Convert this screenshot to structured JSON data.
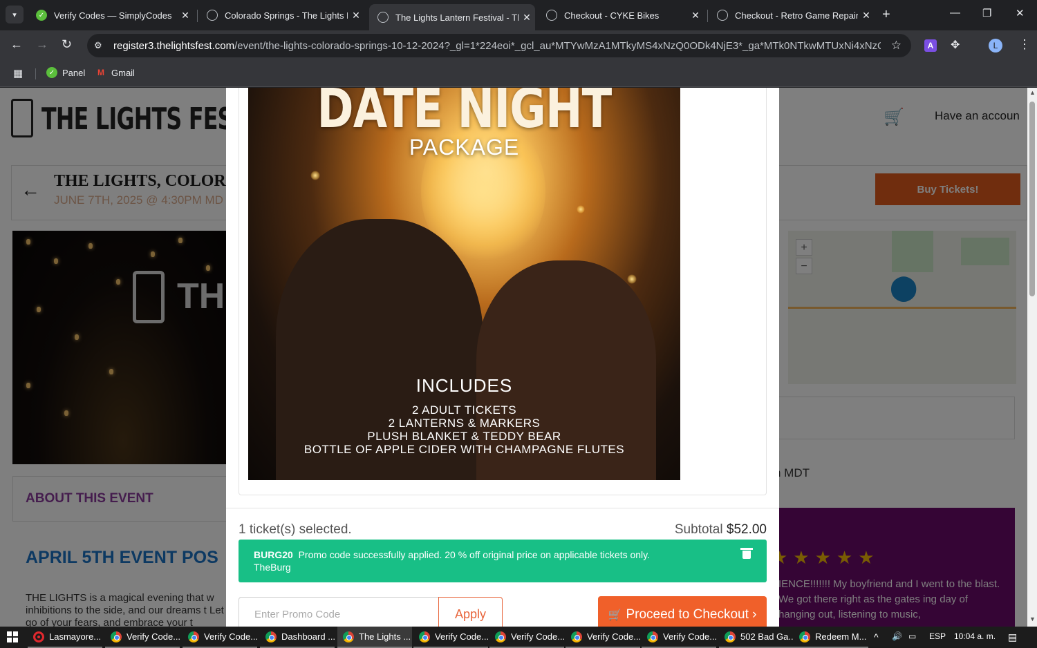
{
  "browser": {
    "tabs": [
      {
        "title": "Verify Codes — SimplyCodes",
        "icon": "simplycodes-icon",
        "active": false
      },
      {
        "title": "Colorado Springs - The Lights L",
        "icon": "globe-icon",
        "active": false
      },
      {
        "title": "The Lights Lantern Festival - Th",
        "icon": "globe-icon",
        "active": true
      },
      {
        "title": "Checkout - CYKE Bikes",
        "icon": "globe-icon",
        "active": false
      },
      {
        "title": "Checkout - Retro Game Repair",
        "icon": "globe-icon",
        "active": false
      }
    ],
    "close_glyph": "✕",
    "new_tab_glyph": "+",
    "url_host": "register3.thelightsfest.com",
    "url_path": "/event/the-lights-colorado-springs-10-12-2024?_gl=1*224eoi*_gcl_au*MTYwMzA1MTkyMS4xNzQ0ODk4NjE3*_ga*MTk0NTkwMTUxNi4xNzQ0O...",
    "extension_badge": "A",
    "profile_initial": "L",
    "bookmarks": [
      {
        "label": "Panel",
        "icon": "simplycodes-icon"
      },
      {
        "label": "Gmail",
        "icon": "gmail-icon"
      }
    ]
  },
  "site": {
    "logo_text": "THE LIGHTS FESTIV",
    "account_link": "Have an accoun",
    "event_title": "THE LIGHTS, COLORA",
    "event_date": "JUNE 7TH, 2025 @ 4:30PM MD",
    "buy_button": "Buy Tickets!",
    "hero_logo_text": "THE",
    "about_title": "ABOUT THIS EVENT",
    "april_title": "APRIL 5TH EVENT POS",
    "event_description": "THE LIGHTS is a magical evening that w inhibitions to the side, and our dreams t Let go of your fears, and embrace your t",
    "mdt_text": "n MDT",
    "review_stars": "★★★★★",
    "review_text": "IENCE!!!!!!! My boyfriend and I went to the blast. We got there right as the gates ing day of hanging out, listening to music,"
  },
  "modal": {
    "poster": {
      "title": "DATE NIGHT",
      "subtitle": "PACKAGE",
      "includes_heading": "INCLUDES",
      "includes": [
        "2 ADULT TICKETS",
        "2 LANTERNS & MARKERS",
        "PLUSH BLANKET & TEDDY BEAR",
        "BOTTLE OF APPLE CIDER WITH CHAMPAGNE FLUTES"
      ]
    },
    "selected_text": "1 ticket(s) selected.",
    "subtotal_label": "Subtotal",
    "subtotal_amount": "$52.00",
    "promo": {
      "code": "BURG20",
      "message": "Promo code successfully applied.  20 % off original price on applicable tickets only.",
      "source": "TheBurg"
    },
    "promo_placeholder": "Enter Promo Code",
    "apply_label": "Apply",
    "checkout_label": "Proceed to Checkout ›"
  },
  "taskbar": {
    "items": [
      {
        "label": "Lasmayore...",
        "icon": "opera-icon"
      },
      {
        "label": "Verify Code...",
        "icon": "chrome-icon"
      },
      {
        "label": "Verify Code...",
        "icon": "chrome-icon"
      },
      {
        "label": "Dashboard ...",
        "icon": "chrome-icon"
      },
      {
        "label": "The Lights ...",
        "icon": "chrome-icon"
      },
      {
        "label": "Verify Code...",
        "icon": "chrome-icon"
      },
      {
        "label": "Verify Code...",
        "icon": "chrome-icon"
      },
      {
        "label": "Verify Code...",
        "icon": "chrome-icon"
      },
      {
        "label": "Verify Code...",
        "icon": "chrome-icon"
      },
      {
        "label": "502 Bad Ga...",
        "icon": "chrome-icon"
      },
      {
        "label": "Redeem M...",
        "icon": "chrome-icon"
      }
    ],
    "language": "ESP",
    "time": "10:04 a. m."
  },
  "colors": {
    "promo_green": "#18bf86",
    "checkout_orange": "#f0602a",
    "buy_orange": "#e15a1d",
    "review_purple": "#6b0b6b"
  }
}
